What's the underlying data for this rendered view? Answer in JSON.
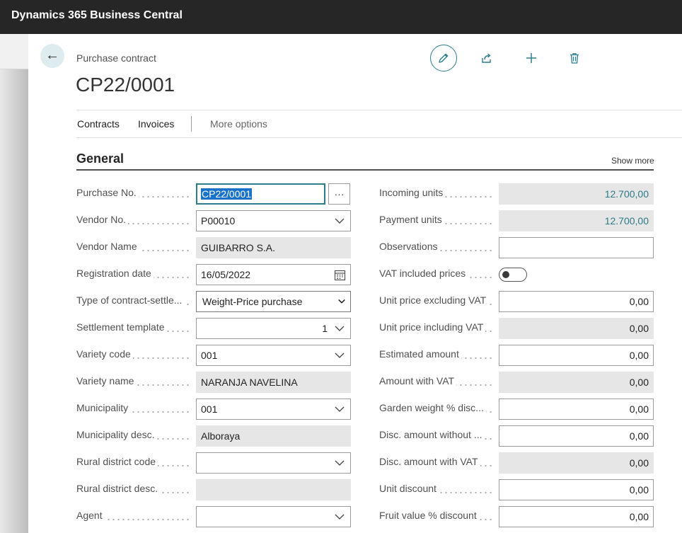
{
  "app": {
    "title": "Dynamics 365 Business Central"
  },
  "page": {
    "caption": "Purchase contract",
    "record_title": "CP22/0001"
  },
  "actions": [
    "edit-icon",
    "share-icon",
    "plus-icon",
    "trash-icon"
  ],
  "nav": {
    "contracts": "Contracts",
    "invoices": "Invoices",
    "more_options": "More options"
  },
  "section": {
    "title": "General",
    "show_more": "Show more"
  },
  "assist_label": "···",
  "left_fields": {
    "purchase_no": {
      "label": "Purchase No.",
      "value": "CP22/0001"
    },
    "vendor_no": {
      "label": "Vendor No.",
      "value": "P00010"
    },
    "vendor_name": {
      "label": "Vendor Name",
      "value": "GUIBARRO S.A."
    },
    "registration_date": {
      "label": "Registration date",
      "value": "16/05/2022"
    },
    "type_of_contract": {
      "label": "Type of contract-settle...",
      "value": "Weight-Price purchase"
    },
    "settlement_template": {
      "label": "Settlement template",
      "value": "1"
    },
    "variety_code": {
      "label": "Variety code",
      "value": "001"
    },
    "variety_name": {
      "label": "Variety name",
      "value": "NARANJA NAVELINA"
    },
    "municipality": {
      "label": "Municipality",
      "value": "001"
    },
    "municipality_desc": {
      "label": "Municipality desc.",
      "value": "Alboraya"
    },
    "rural_district_code": {
      "label": "Rural district code",
      "value": ""
    },
    "rural_district_desc": {
      "label": "Rural district desc.",
      "value": ""
    },
    "agent": {
      "label": "Agent",
      "value": ""
    }
  },
  "right_fields": {
    "incoming_units": {
      "label": "Incoming units",
      "value": "12.700,00"
    },
    "payment_units": {
      "label": "Payment units",
      "value": "12.700,00"
    },
    "observations": {
      "label": "Observations",
      "value": ""
    },
    "vat_included_prices": {
      "label": "VAT included prices",
      "value": false
    },
    "unit_price_excl_vat": {
      "label": "Unit price excluding VAT",
      "value": "0,00"
    },
    "unit_price_incl_vat": {
      "label": "Unit price including VAT",
      "value": "0,00"
    },
    "estimated_amount": {
      "label": "Estimated amount",
      "value": "0,00"
    },
    "amount_with_vat": {
      "label": "Amount with VAT",
      "value": "0,00"
    },
    "garden_weight_disc": {
      "label": "Garden weight % disc...",
      "value": "0,00"
    },
    "disc_amount_without": {
      "label": "Disc. amount without ...",
      "value": "0,00"
    },
    "disc_amount_with_vat": {
      "label": "Disc. amount with VAT",
      "value": "0,00"
    },
    "unit_discount": {
      "label": "Unit discount",
      "value": "0,00"
    },
    "fruit_value_discount": {
      "label": "Fruit value % discount",
      "value": "0,00"
    }
  },
  "colors": {
    "topbar": "#262626",
    "accent": "#2e7d8f",
    "teal_value": "#2c7b88",
    "readonly_bg": "#e6e6e6"
  }
}
